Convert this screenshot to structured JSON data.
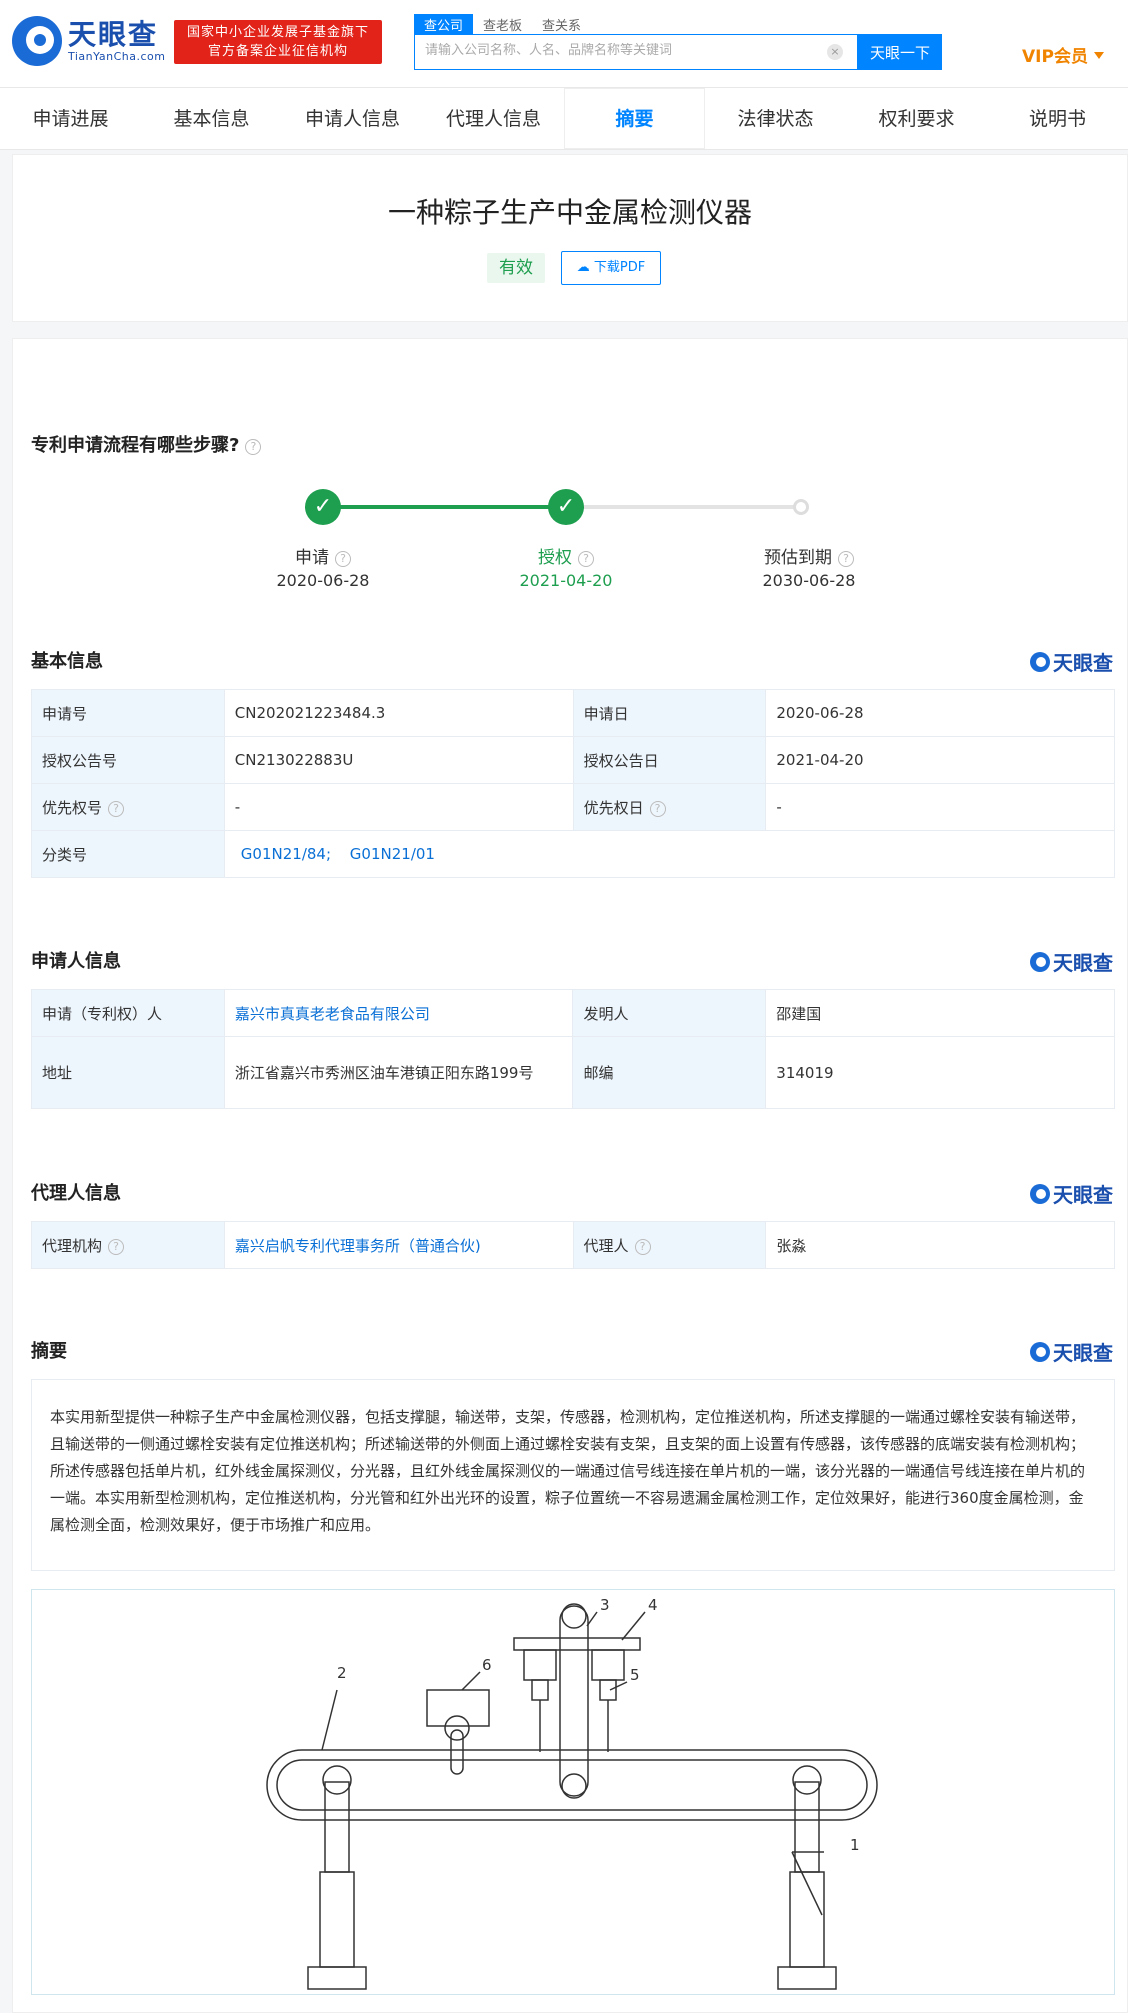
{
  "header": {
    "logo_cn": "天眼查",
    "logo_en": "TianYanCha.com",
    "badge_line1": "国家中小企业发展子基金旗下",
    "badge_line2": "官方备案企业征信机构",
    "search_tabs": [
      "查公司",
      "查老板",
      "查关系"
    ],
    "search_placeholder": "请输入公司名称、人名、品牌名称等关键词",
    "search_button": "天眼一下",
    "vip_label": "VIP会员"
  },
  "nav": {
    "tabs": [
      "申请进展",
      "基本信息",
      "申请人信息",
      "代理人信息",
      "摘要",
      "法律状态",
      "权利要求",
      "说明书"
    ],
    "active_index": 4
  },
  "patent": {
    "title": "一种粽子生产中金属检测仪器",
    "status": "有效",
    "download_label": "下载PDF"
  },
  "timeline": {
    "section_title": "专利申请流程有哪些步骤?",
    "steps": [
      {
        "label": "申请",
        "date": "2020-06-28",
        "done": true
      },
      {
        "label": "授权",
        "date": "2021-04-20",
        "done": true
      },
      {
        "label": "预估到期",
        "date": "2030-06-28",
        "done": false
      }
    ]
  },
  "brand": "天眼查",
  "basic_info": {
    "section_title": "基本信息",
    "application_no_label": "申请号",
    "application_no": "CN202021223484.3",
    "application_date_label": "申请日",
    "application_date": "2020-06-28",
    "grant_no_label": "授权公告号",
    "grant_no": "CN213022883U",
    "grant_date_label": "授权公告日",
    "grant_date": "2021-04-20",
    "priority_no_label": "优先权号",
    "priority_no": "-",
    "priority_date_label": "优先权日",
    "priority_date": "-",
    "class_label": "分类号",
    "class_1": "G01N21/84;",
    "class_2": "G01N21/01"
  },
  "applicant_info": {
    "section_title": "申请人信息",
    "applicant_label": "申请（专利权）人",
    "applicant": "嘉兴市真真老老食品有限公司",
    "inventor_label": "发明人",
    "inventor": "邵建国",
    "address_label": "地址",
    "address": "浙江省嘉兴市秀洲区油车港镇正阳东路199号",
    "postcode_label": "邮编",
    "postcode": "314019"
  },
  "agent_info": {
    "section_title": "代理人信息",
    "agency_label": "代理机构",
    "agency": "嘉兴启帆专利代理事务所（普通合伙)",
    "agent_label": "代理人",
    "agent": "张淼"
  },
  "abstract": {
    "section_title": "摘要",
    "text": "本实用新型提供一种粽子生产中金属检测仪器，包括支撑腿，输送带，支架，传感器，检测机构，定位推送机构，所述支撑腿的一端通过螺栓安装有输送带，且输送带的一侧通过螺栓安装有定位推送机构；所述输送带的外侧面上通过螺栓安装有支架，且支架的面上设置有传感器，该传感器的底端安装有检测机构；所述传感器包括单片机，红外线金属探测仪，分光器，且红外线金属探测仪的一端通过信号线连接在单片机的一端，该分光器的一端通信号线连接在单片机的一端。本实用新型检测机构，定位推送机构，分光管和红外出光环的设置，粽子位置统一不容易遗漏金属检测工作，定位效果好，能进行360度金属检测，金属检测全面，检测效果好，便于市场推广和应用。"
  },
  "drawing": {
    "part_labels": [
      "1",
      "2",
      "3",
      "4",
      "5",
      "6"
    ]
  }
}
